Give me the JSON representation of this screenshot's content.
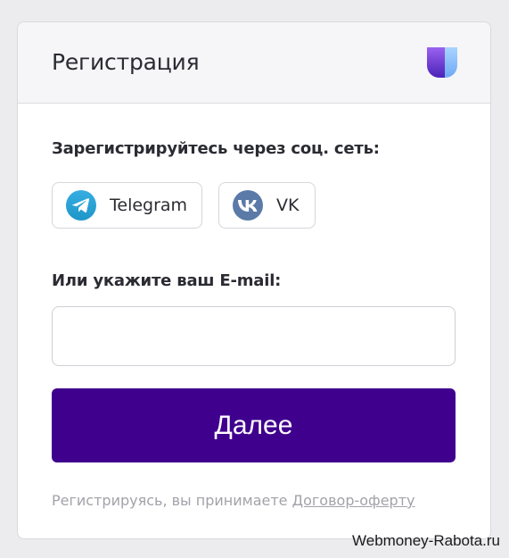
{
  "header": {
    "title": "Регистрация",
    "logo_icon": "brand-u-logo",
    "logo_colors": [
      "#7b3fe4",
      "#4a22b8"
    ]
  },
  "social": {
    "label": "Зарегистрируйтесь через соц. сеть:",
    "buttons": [
      {
        "label": "Telegram",
        "icon": "telegram-icon",
        "color": "#2aa3db"
      },
      {
        "label": "VK",
        "icon": "vk-icon",
        "color": "#5b7aa8"
      }
    ]
  },
  "email": {
    "label": "Или укажите ваш E-mail:",
    "value": "",
    "placeholder": ""
  },
  "submit": {
    "label": "Далее",
    "color": "#40008e"
  },
  "agreement": {
    "text": "Регистрируясь, вы принимаете ",
    "link_label": "Договор-оферту"
  },
  "watermark": "Webmoney-Rabota.ru"
}
